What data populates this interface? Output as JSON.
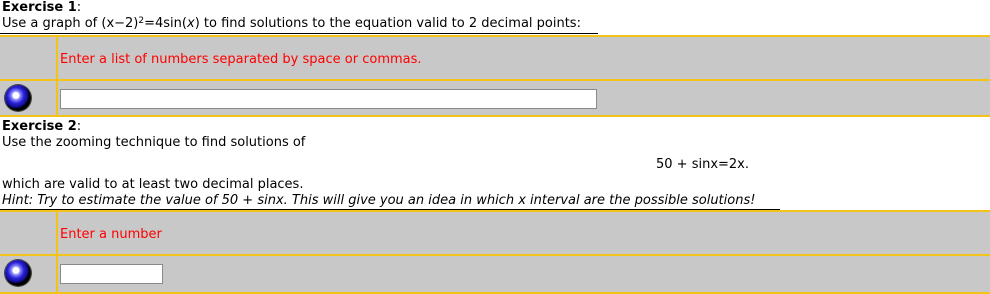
{
  "exercise1": {
    "title": "Exercise 1",
    "colon": ":",
    "prompt_before": "Use a graph of ",
    "eq_left": "(x−2)",
    "eq_sup": "2",
    "eq_mid": "=4sin(",
    "eq_x": "x",
    "eq_end": ")",
    "prompt_after": " to find solutions to the equation valid to 2 decimal points:",
    "instruction": "Enter a list of numbers separated by space or commas.",
    "answer_value": ""
  },
  "exercise2": {
    "title": "Exercise 2",
    "colon": ":",
    "prompt": "Use the zooming technique to find solutions of",
    "equation": "50 + sinx=2x.",
    "followup": "which are valid to at least two decimal places.",
    "hint": "Hint: Try to estimate the value of 50 + sinx. This will give you an idea in which x interval are the possible solutions!",
    "instruction": "Enter a number",
    "answer_value": ""
  },
  "colors": {
    "panel_bg": "#c8c8c8",
    "border": "#f2c318",
    "instruction": "#ff0000",
    "radio": "#2a22d8"
  },
  "icons": {
    "submit": "radio-button-icon"
  }
}
